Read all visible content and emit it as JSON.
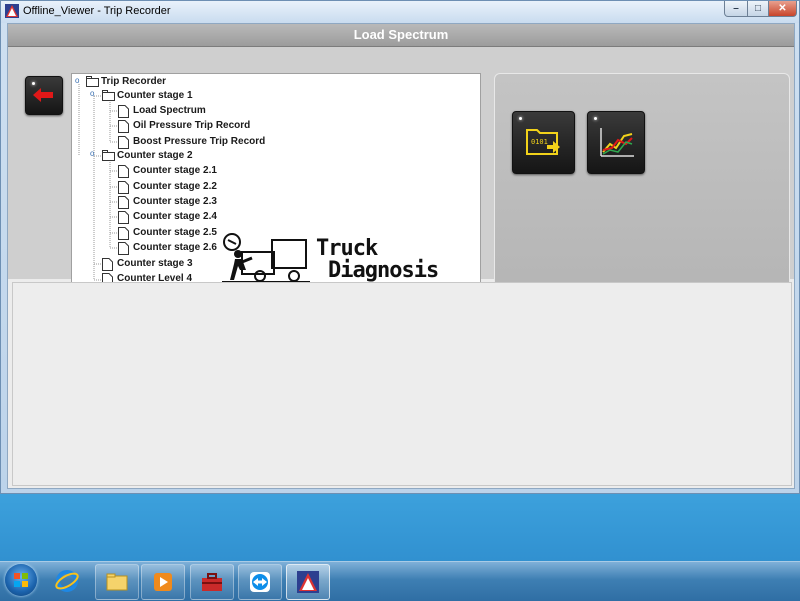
{
  "window": {
    "title": "Offline_Viewer - Trip Recorder",
    "controls": {
      "minimize": "–",
      "maximize": "□",
      "close": "✕"
    }
  },
  "header": {
    "title": "Load Spectrum"
  },
  "toolbar": {
    "back_icon": "red-left-arrow-icon",
    "export_icon": "folder-binary-export-icon",
    "graph_icon": "line-graph-icon"
  },
  "tree": {
    "root": "Trip Recorder",
    "stage1": "Counter stage 1",
    "stage1_items": [
      "Load Spectrum",
      "Oil Pressure Trip Record",
      "Boost Pressure Trip Record"
    ],
    "stage2": "Counter stage 2",
    "stage2_items": [
      "Counter stage 2.1",
      "Counter stage 2.2",
      "Counter stage 2.3",
      "Counter stage 2.4",
      "Counter stage 2.5",
      "Counter stage 2.6"
    ],
    "stage3": "Counter stage 3",
    "level4": "Counter Level 4"
  },
  "logo": {
    "line1": "Truck",
    "line2": "Diagnosis"
  },
  "taskbar": {
    "items": [
      "start-orb-icon",
      "internet-explorer-icon",
      "file-explorer-icon",
      "media-player-icon",
      "toolbox-icon",
      "teamviewer-icon",
      "offline-viewer-icon"
    ]
  },
  "colors": {
    "header_bg": "#a9a9a9",
    "tree_bg": "#ffffff",
    "button_dark": "#1c1c1c",
    "accent_red": "#e01818",
    "accent_yellow": "#f2d21a"
  }
}
